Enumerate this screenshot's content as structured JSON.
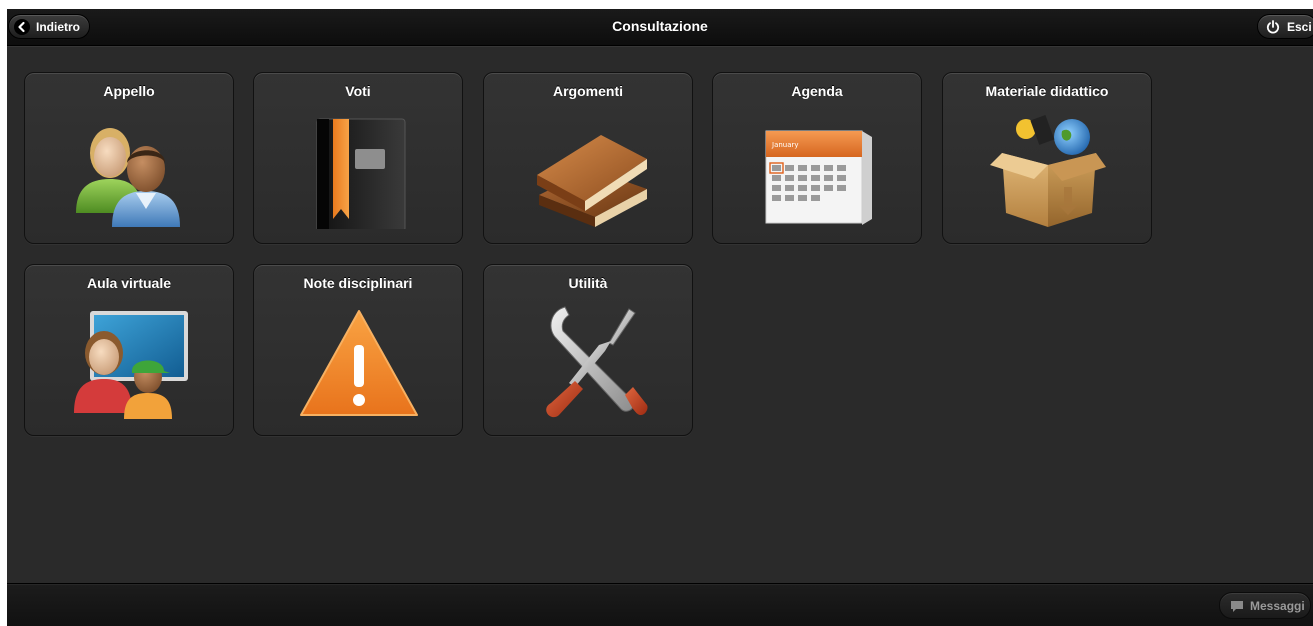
{
  "header": {
    "title": "Consultazione",
    "back_label": "Indietro",
    "exit_label": "Esci"
  },
  "tiles": [
    {
      "label": "Appello",
      "icon": "people-icon"
    },
    {
      "label": "Voti",
      "icon": "gradebook-icon"
    },
    {
      "label": "Argomenti",
      "icon": "books-icon"
    },
    {
      "label": "Agenda",
      "icon": "calendar-icon"
    },
    {
      "label": "Materiale didattico",
      "icon": "box-icon"
    },
    {
      "label": "Aula virtuale",
      "icon": "classroom-icon"
    },
    {
      "label": "Note disciplinari",
      "icon": "warning-icon"
    },
    {
      "label": "Utilità",
      "icon": "tools-icon"
    }
  ],
  "calendar": {
    "month": "January"
  },
  "footer": {
    "messages_label": "Messaggi"
  },
  "colors": {
    "background": "#2a2a2a",
    "header": "#111111",
    "warning": "#f28c28"
  }
}
